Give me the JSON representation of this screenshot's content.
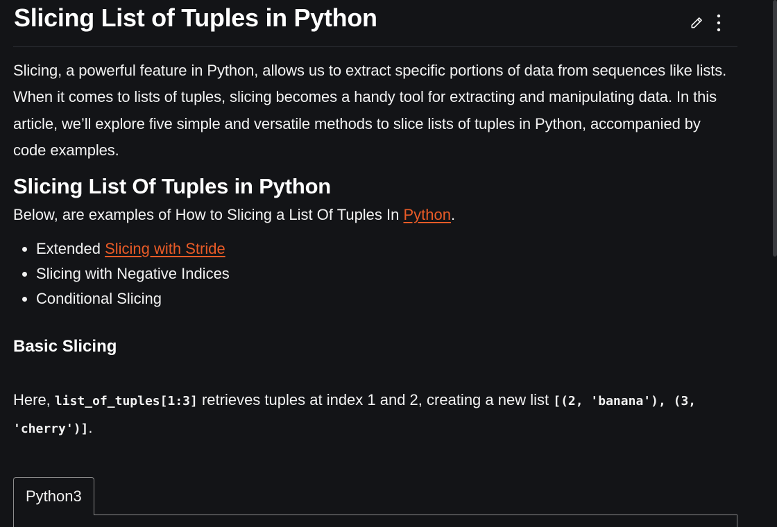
{
  "article": {
    "title": "Slicing List of Tuples in Python",
    "intro": "Slicing, a powerful feature in Python, allows us to extract specific portions of data from sequences like lists. When it comes to lists of tuples, slicing becomes a handy tool for extracting and manipulating data. In this article, we’ll explore five simple and versatile methods to slice lists of tuples in Python, accompanied by code examples.",
    "section_heading": "Slicing List Of Tuples in Python",
    "below_prefix": "Below, are examples of How to Slicing a List Of Tuples In ",
    "below_link": "Python",
    "below_suffix": ".",
    "methods": [
      {
        "prefix": "Extended ",
        "link": "Slicing with Stride"
      },
      {
        "text": "Slicing with Negative Indices"
      },
      {
        "text": "Conditional Slicing"
      }
    ],
    "subheading": "Basic Slicing",
    "here_prefix": "Here, ",
    "here_code1": "list_of_tuples[1:3]",
    "here_middle": " retrieves tuples at index 1 and 2, creating a new list ",
    "here_code2": "[(2, 'banana'), (3, 'cherry')]",
    "here_suffix": "."
  },
  "icons": {
    "edit": "pencil-icon",
    "more": "more-vertical-icon"
  },
  "code_tabs": {
    "active_tab": "Python3"
  },
  "colors": {
    "background": "#131417",
    "link": "#e95b27",
    "text": "#ffffff"
  }
}
